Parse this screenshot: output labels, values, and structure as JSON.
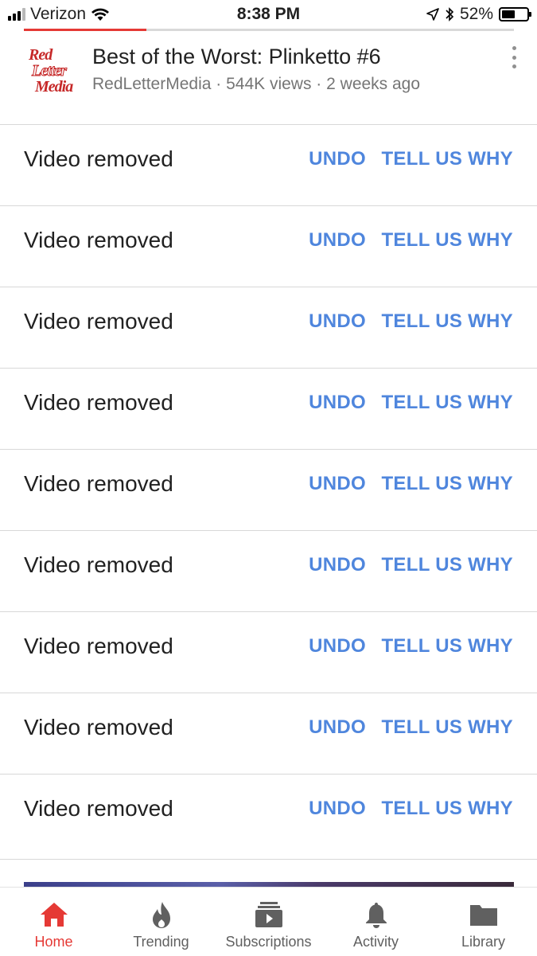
{
  "status_bar": {
    "carrier": "Verizon",
    "time": "8:38 PM",
    "battery_percent": "52%",
    "battery_level": 0.52,
    "signal_bars_filled": 3,
    "icons": [
      "signal-icon",
      "wifi-icon",
      "location-icon",
      "bluetooth-icon",
      "battery-icon"
    ]
  },
  "playback_progress": 0.25,
  "video": {
    "title": "Best of the Worst: Plinketto #6",
    "meta": "RedLetterMedia · 544K views · 2 weeks ago",
    "channel_logo_lines": [
      "Red",
      "Letter",
      "Media"
    ],
    "menu_icon": "more-vertical-icon"
  },
  "removed_items": [
    {
      "message": "Video removed",
      "undo": "UNDO",
      "why": "TELL US WHY"
    },
    {
      "message": "Video removed",
      "undo": "UNDO",
      "why": "TELL US WHY"
    },
    {
      "message": "Video removed",
      "undo": "UNDO",
      "why": "TELL US WHY"
    },
    {
      "message": "Video removed",
      "undo": "UNDO",
      "why": "TELL US WHY"
    },
    {
      "message": "Video removed",
      "undo": "UNDO",
      "why": "TELL US WHY"
    },
    {
      "message": "Video removed",
      "undo": "UNDO",
      "why": "TELL US WHY"
    },
    {
      "message": "Video removed",
      "undo": "UNDO",
      "why": "TELL US WHY"
    },
    {
      "message": "Video removed",
      "undo": "UNDO",
      "why": "TELL US WHY"
    },
    {
      "message": "Video removed",
      "undo": "UNDO",
      "why": "TELL US WHY"
    }
  ],
  "bottom_nav": [
    {
      "label": "Home",
      "icon": "home-icon",
      "active": true
    },
    {
      "label": "Trending",
      "icon": "flame-icon",
      "active": false
    },
    {
      "label": "Subscriptions",
      "icon": "subscriptions-icon",
      "active": false
    },
    {
      "label": "Activity",
      "icon": "bell-icon",
      "active": false
    },
    {
      "label": "Library",
      "icon": "folder-icon",
      "active": false
    }
  ],
  "colors": {
    "accent_red": "#e53935",
    "link_blue": "#4f86dd",
    "icon_gray": "#606060"
  }
}
